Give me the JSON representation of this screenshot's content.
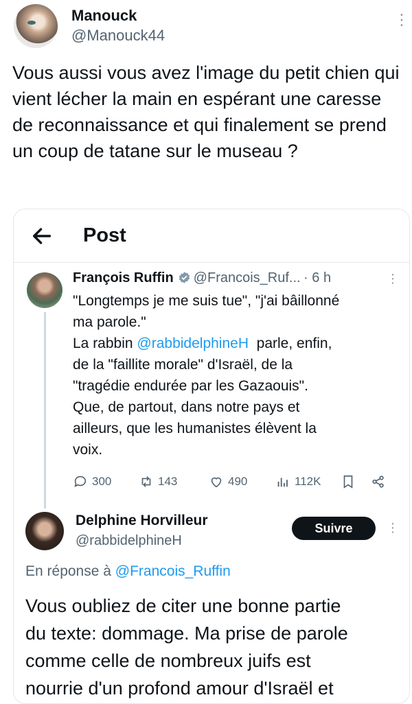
{
  "tweet": {
    "author_name": "Manouck",
    "author_handle": "@Manouck44",
    "text": "Vous aussi vous avez l'image du petit chien qui vient lécher la main en espérant une caresse de reconnaissance et qui finalement se prend un coup de tatane sur le museau ?"
  },
  "quoted": {
    "header_title": "Post",
    "post": {
      "author_name": "François Ruffin",
      "author_handle": "@Francois_Ruf...",
      "time": "· 6 h",
      "lines": [
        "\"Longtemps je me suis tue\", \"j'ai bâillonné",
        "ma parole.\""
      ],
      "line3_prefix": "La rabbin ",
      "line3_mention": "@rabbidelphineH",
      "line3_suffix": "  parle, enfin,",
      "lines_after": [
        "de la \"faillite morale\" d'Israël, de la",
        "\"tragédie endurée par les Gazaouis\".",
        "Que, de partout, dans notre pays et",
        "ailleurs, que les humanistes élèvent la",
        "voix."
      ],
      "stats": {
        "replies": "300",
        "reposts": "143",
        "likes": "490",
        "views": "112K"
      }
    },
    "reply": {
      "author_name": "Delphine Horvilleur",
      "author_handle": "@rabbidelphineH",
      "follow_label": "Suivre",
      "reply_to_prefix": "En réponse à ",
      "reply_to_handle": "@Francois_Ruffin",
      "lines": [
        "Vous oubliez de citer une bonne partie",
        "du texte: dommage. Ma prise de parole",
        "comme celle de nombreux juifs est",
        "nourrie d'un profond amour d'Israël et"
      ]
    }
  },
  "colors": {
    "accent": "#1d9bf0",
    "text": "#0f1419",
    "secondary": "#536471",
    "border": "#e3e7ea"
  }
}
